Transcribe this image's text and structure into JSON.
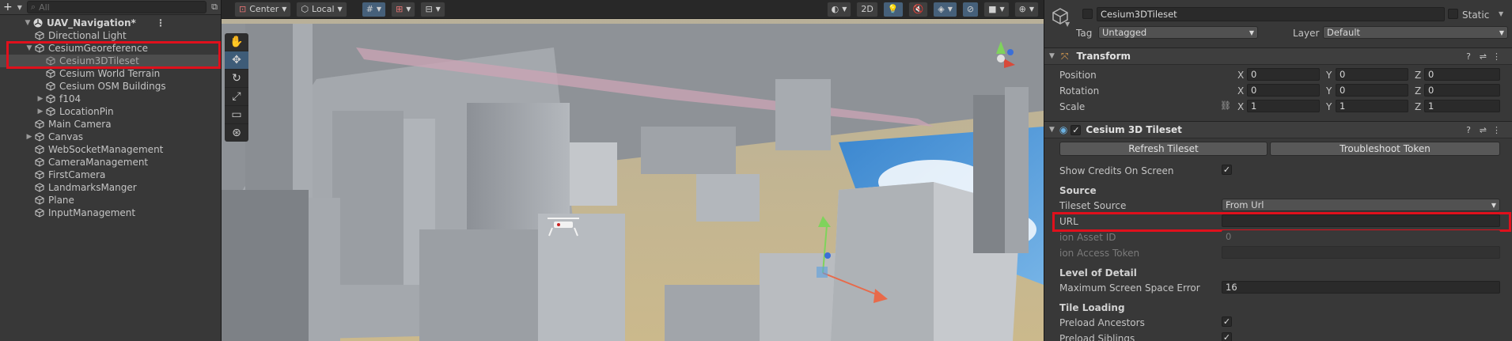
{
  "hierarchy": {
    "add_label": "+",
    "search_placeholder": "All",
    "scene_name": "UAV_Navigation*",
    "items": [
      {
        "label": "Directional Light",
        "depth": 1,
        "arrow": ""
      },
      {
        "label": "CesiumGeoreference",
        "depth": 1,
        "arrow": "▼"
      },
      {
        "label": "Cesium3DTileset",
        "depth": 2,
        "arrow": "",
        "selected": true
      },
      {
        "label": "Cesium World Terrain",
        "depth": 2,
        "arrow": ""
      },
      {
        "label": "Cesium OSM Buildings",
        "depth": 2,
        "arrow": ""
      },
      {
        "label": "f104",
        "depth": 2,
        "arrow": "▶"
      },
      {
        "label": "LocationPin",
        "depth": 2,
        "arrow": "▶"
      },
      {
        "label": "Main Camera",
        "depth": 1,
        "arrow": ""
      },
      {
        "label": "Canvas",
        "depth": 1,
        "arrow": "▶"
      },
      {
        "label": "WebSocketManagement",
        "depth": 1,
        "arrow": ""
      },
      {
        "label": "CameraManagement",
        "depth": 1,
        "arrow": ""
      },
      {
        "label": "FirstCamera",
        "depth": 1,
        "arrow": ""
      },
      {
        "label": "LandmarksManger",
        "depth": 1,
        "arrow": ""
      },
      {
        "label": "Plane",
        "depth": 1,
        "arrow": ""
      },
      {
        "label": "InputManagement",
        "depth": 1,
        "arrow": ""
      }
    ]
  },
  "scene": {
    "pivot_label": "Center",
    "space_label": "Local",
    "mode_2d": "2D"
  },
  "inspector": {
    "object_name": "Cesium3DTileset",
    "static_label": "Static",
    "tag_label": "Tag",
    "tag_value": "Untagged",
    "layer_label": "Layer",
    "layer_value": "Default",
    "transform": {
      "title": "Transform",
      "position_label": "Position",
      "rotation_label": "Rotation",
      "scale_label": "Scale",
      "position": {
        "x": "0",
        "y": "0",
        "z": "0"
      },
      "rotation": {
        "x": "0",
        "y": "0",
        "z": "0"
      },
      "scale": {
        "x": "1",
        "y": "1",
        "z": "1"
      },
      "axis_x": "X",
      "axis_y": "Y",
      "axis_z": "Z"
    },
    "tileset": {
      "title": "Cesium 3D Tileset",
      "refresh_button": "Refresh Tileset",
      "troubleshoot_button": "Troubleshoot Token",
      "show_credits_label": "Show Credits On Screen",
      "source_section": "Source",
      "tileset_source_label": "Tileset Source",
      "tileset_source_value": "From Url",
      "url_label": "URL",
      "url_value": "",
      "ion_asset_id_label": "ion Asset ID",
      "ion_asset_id_value": "0",
      "ion_access_token_label": "ion Access Token",
      "ion_access_token_value": "",
      "lod_section": "Level of Detail",
      "max_sse_label": "Maximum Screen Space Error",
      "max_sse_value": "16",
      "tile_loading_section": "Tile Loading",
      "preload_ancestors_label": "Preload Ancestors",
      "preload_siblings_label": "Preload Siblings"
    }
  },
  "colors": {
    "highlight_red": "#e0101c",
    "selection": "#4d4d4d"
  }
}
